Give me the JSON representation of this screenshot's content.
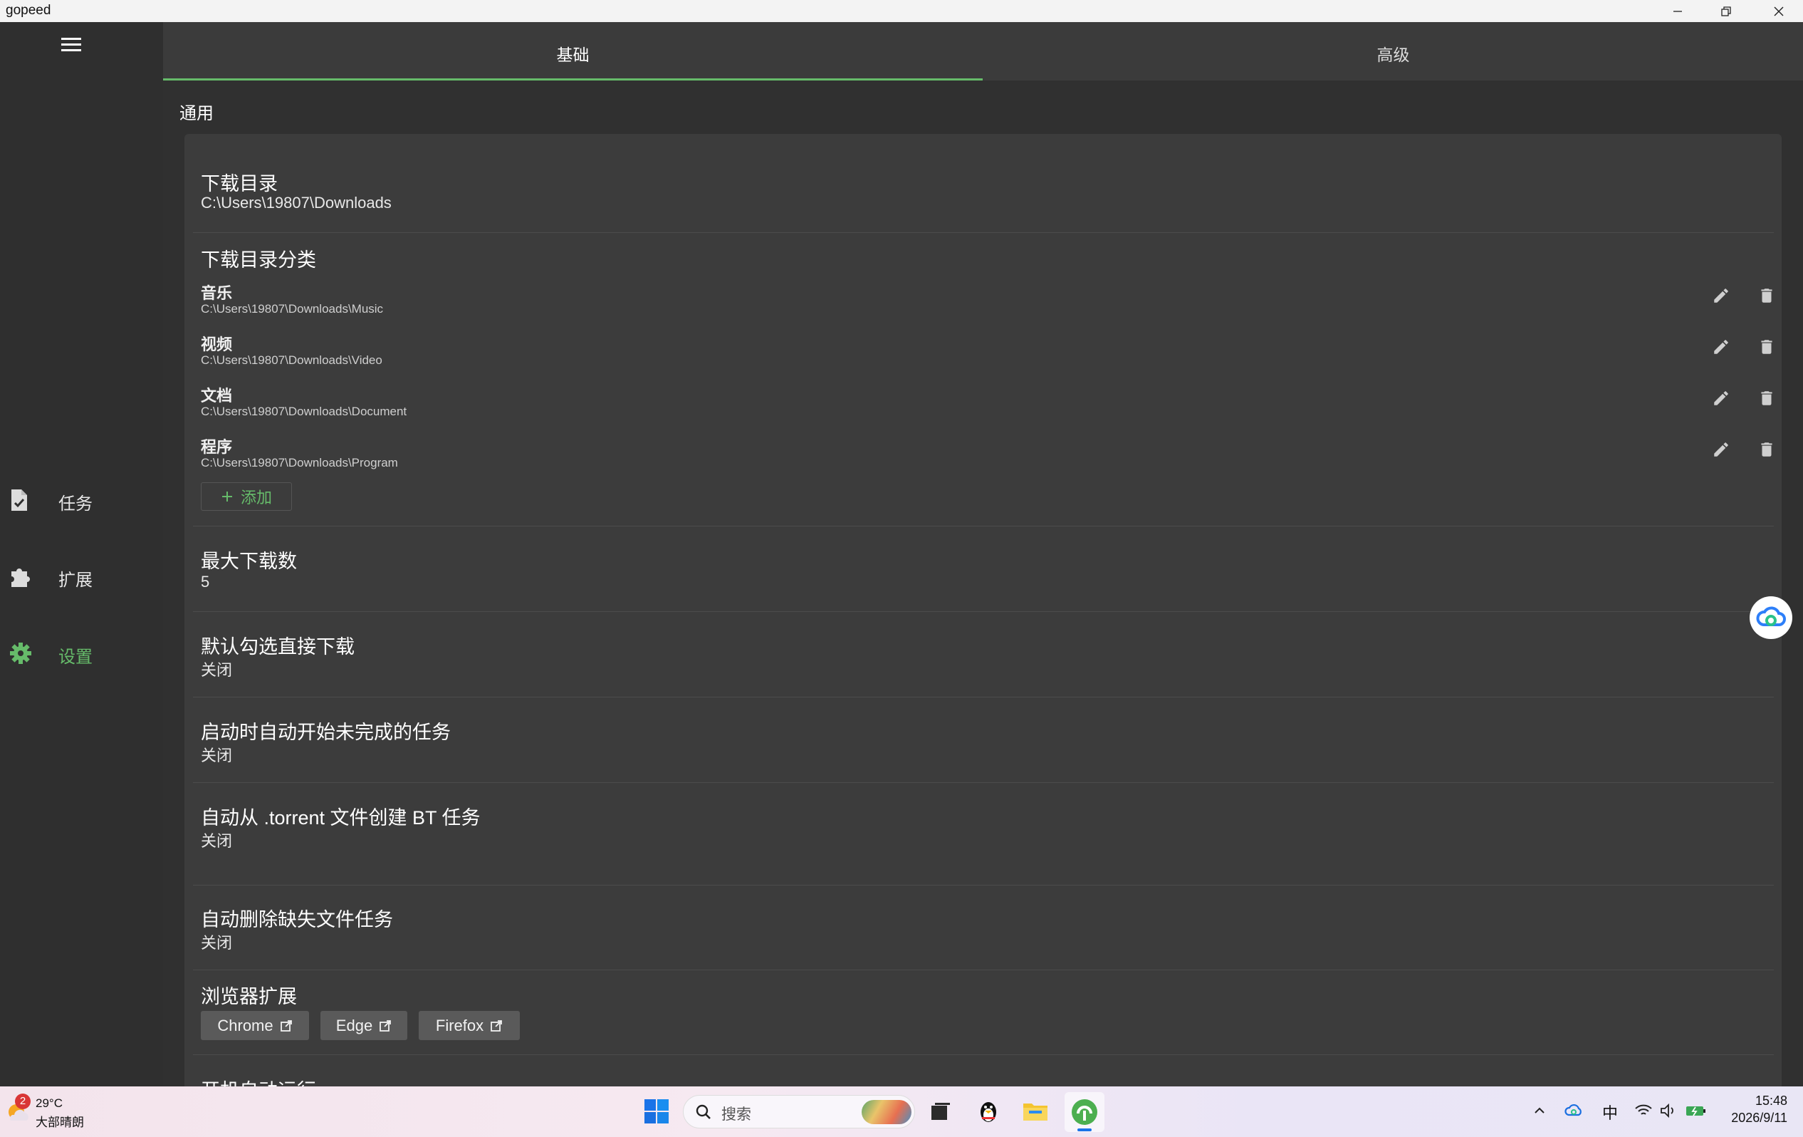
{
  "window": {
    "title": "gopeed"
  },
  "sidebar": {
    "items": [
      {
        "label": "任务",
        "icon": "task-file-icon",
        "active": false
      },
      {
        "label": "扩展",
        "icon": "puzzle-icon",
        "active": false
      },
      {
        "label": "设置",
        "icon": "gear-icon",
        "active": true
      }
    ]
  },
  "tabs": [
    {
      "label": "基础",
      "selected": true
    },
    {
      "label": "高级",
      "selected": false
    }
  ],
  "settings": {
    "section_title": "通用",
    "download_dir": {
      "title": "下载目录",
      "value": "C:\\Users\\19807\\Downloads"
    },
    "categories": {
      "title": "下载目录分类",
      "items": [
        {
          "name": "音乐",
          "path": "C:\\Users\\19807\\Downloads\\Music"
        },
        {
          "name": "视频",
          "path": "C:\\Users\\19807\\Downloads\\Video"
        },
        {
          "name": "文档",
          "path": "C:\\Users\\19807\\Downloads\\Document"
        },
        {
          "name": "程序",
          "path": "C:\\Users\\19807\\Downloads\\Program"
        }
      ],
      "add_label": "添加"
    },
    "max_downloads": {
      "title": "最大下载数",
      "value": "5"
    },
    "default_direct": {
      "title": "默认勾选直接下载",
      "value": "关闭"
    },
    "auto_start": {
      "title": "启动时自动开始未完成的任务",
      "value": "关闭"
    },
    "auto_torrent": {
      "title": "自动从 .torrent 文件创建 BT 任务",
      "value": "关闭"
    },
    "auto_delete": {
      "title": "自动删除缺失文件任务",
      "value": "关闭"
    },
    "browser_ext": {
      "title": "浏览器扩展",
      "buttons": [
        "Chrome",
        "Edge",
        "Firefox"
      ]
    },
    "autostart_partial": {
      "title": "开机自动运行"
    }
  },
  "taskbar": {
    "weather": {
      "temp": "29°C",
      "desc": "大部晴朗",
      "badge": "2"
    },
    "search_placeholder": "搜索",
    "tray": {
      "ime": "中"
    },
    "clock": {
      "time": "15:48",
      "date": "2026/9/11"
    }
  },
  "colors": {
    "accent": "#66bb6a",
    "card": "#3c3c3c",
    "sidebar": "#2f2f2f",
    "main": "#303030"
  }
}
